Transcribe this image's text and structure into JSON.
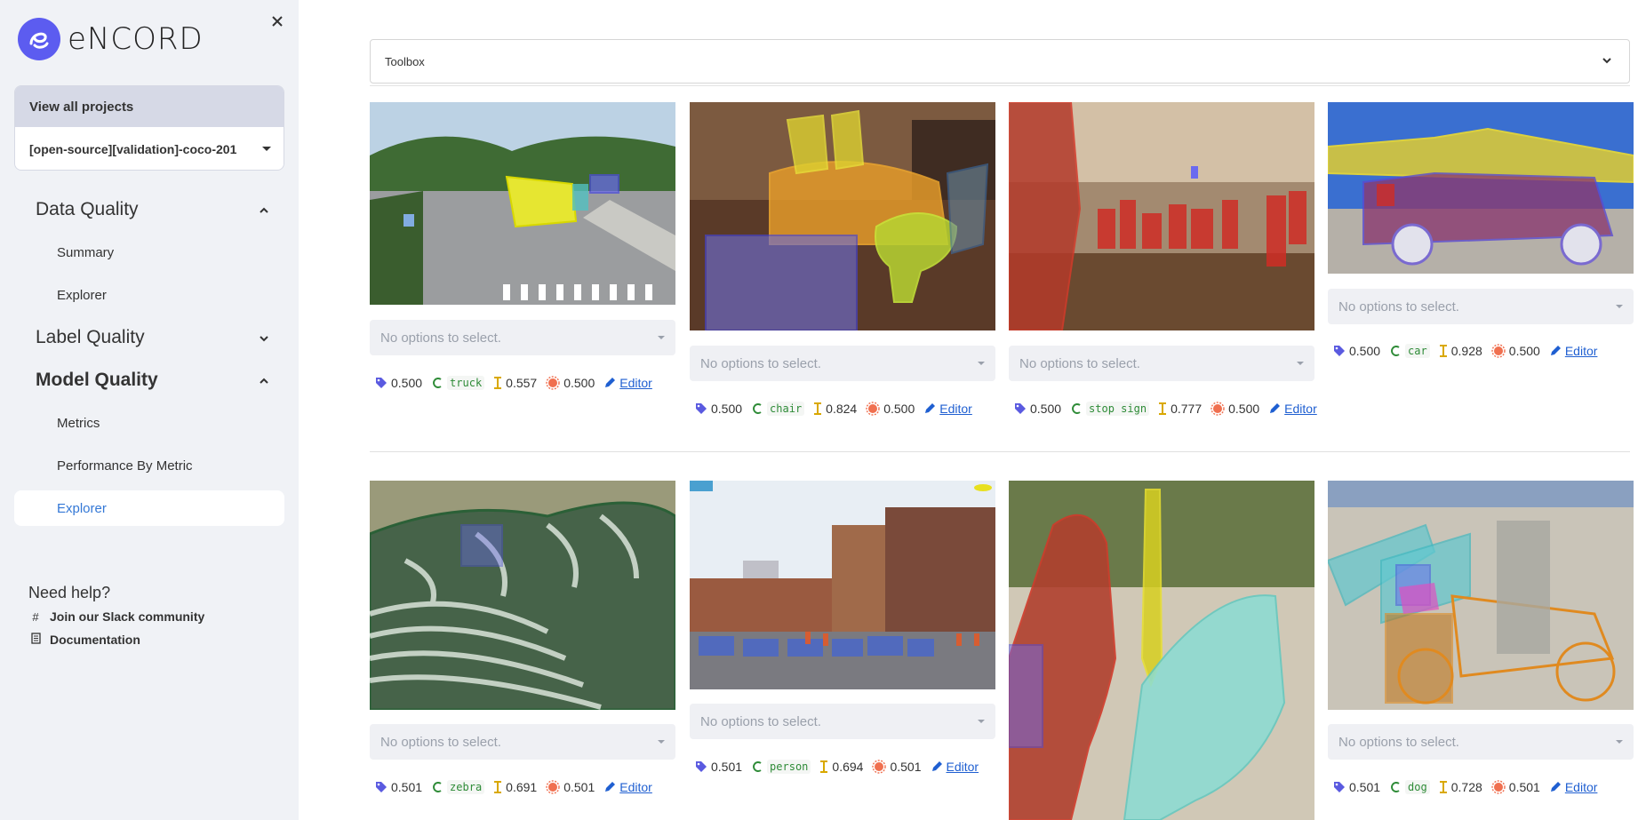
{
  "brand": {
    "name": "eNCORD"
  },
  "sidebar": {
    "view_all": "View all projects",
    "project": "[open-source][validation]-coco-201",
    "sections": [
      {
        "label": "Data Quality",
        "expanded": true,
        "items": [
          "Summary",
          "Explorer"
        ]
      },
      {
        "label": "Label Quality",
        "expanded": false,
        "items": []
      },
      {
        "label": "Model Quality",
        "expanded": true,
        "items": [
          "Metrics",
          "Performance By Metric",
          "Explorer"
        ]
      }
    ],
    "active_item": "Explorer",
    "help_title": "Need help?",
    "help_links": [
      "Join our Slack community",
      "Documentation"
    ]
  },
  "toolbox": {
    "label": "Toolbox"
  },
  "select_placeholder": "No options to select.",
  "editor_label": "Editor",
  "colors": {
    "accent": "#3478d6",
    "brand": "#5c5cf0",
    "class_text": "#2e8b37",
    "editor_link": "#1f5fd1"
  },
  "cards": [
    {
      "score": "0.500",
      "cls": "truck",
      "iou": "0.557",
      "conf": "0.500"
    },
    {
      "score": "0.500",
      "cls": "chair",
      "iou": "0.824",
      "conf": "0.500"
    },
    {
      "score": "0.500",
      "cls": "stop sign",
      "iou": "0.777",
      "conf": "0.500"
    },
    {
      "score": "0.500",
      "cls": "car",
      "iou": "0.928",
      "conf": "0.500"
    },
    {
      "score": "0.501",
      "cls": "zebra",
      "iou": "0.691",
      "conf": "0.501"
    },
    {
      "score": "0.501",
      "cls": "person",
      "iou": "0.694",
      "conf": "0.501"
    },
    {
      "score": "",
      "cls": "",
      "iou": "",
      "conf": ""
    },
    {
      "score": "0.501",
      "cls": "dog",
      "iou": "0.728",
      "conf": "0.501"
    }
  ]
}
